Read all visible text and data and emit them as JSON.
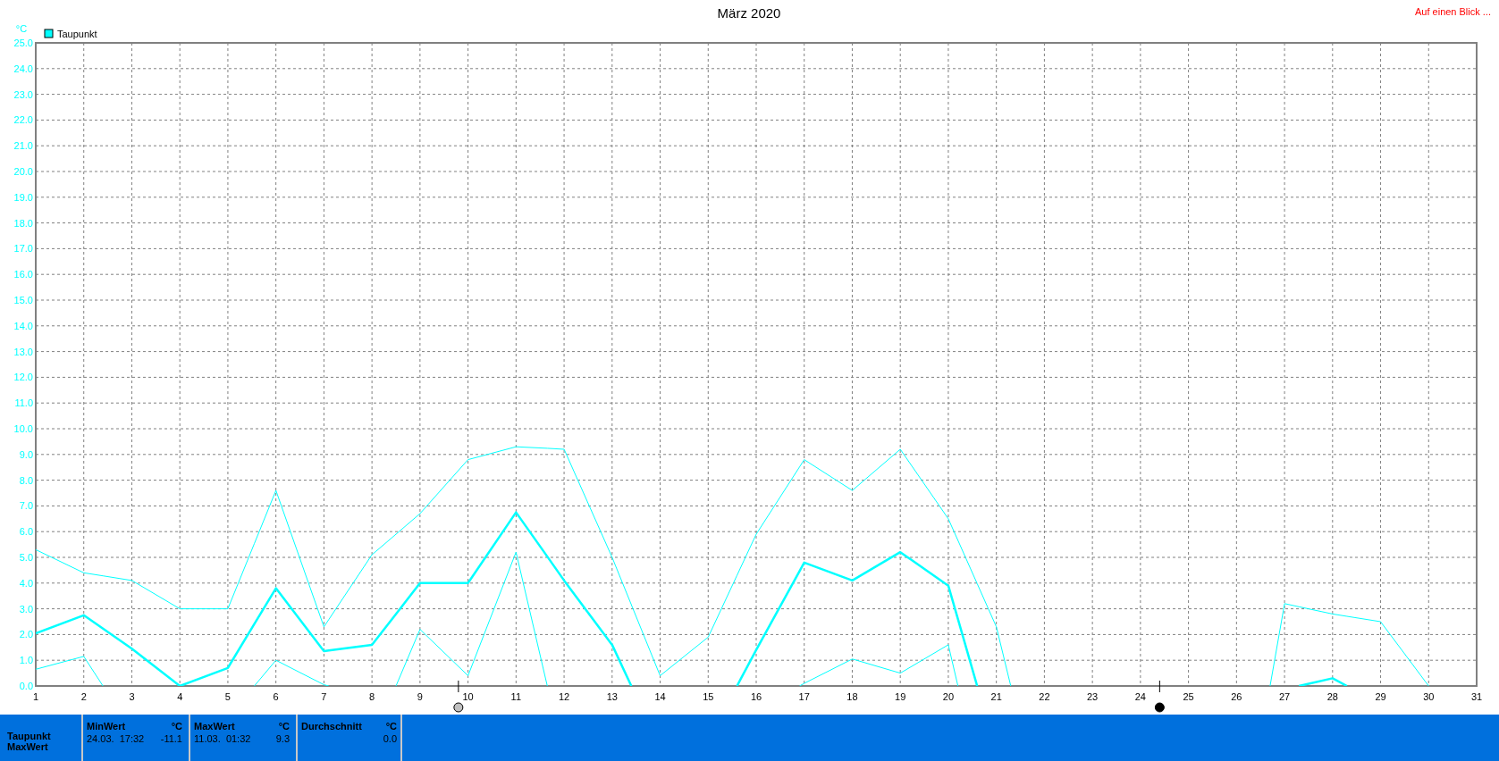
{
  "chart": {
    "unit": "°C",
    "legend": [
      {
        "label": "Taupunkt",
        "color": "#00ffff"
      }
    ],
    "chart_data": {
      "type": "line",
      "title": "März 2020",
      "xlim": [
        1,
        31
      ],
      "ylim": [
        0,
        25
      ],
      "grid": true,
      "x": [
        1,
        2,
        2.4,
        3,
        4,
        5,
        5.55,
        6,
        7,
        7.1,
        8,
        8.5,
        9,
        10,
        11,
        11.65,
        12,
        13,
        13.4,
        14,
        15,
        15.6,
        16,
        16.9,
        17,
        18,
        19,
        20,
        20.2,
        20.6,
        21,
        21.3,
        22,
        23,
        24,
        25,
        26,
        26.7,
        27,
        27.3,
        28,
        28.3,
        29,
        30
      ],
      "xticks": [
        1,
        2,
        3,
        4,
        5,
        6,
        7,
        8,
        9,
        10,
        11,
        12,
        13,
        14,
        15,
        16,
        17,
        18,
        19,
        20,
        21,
        22,
        23,
        24,
        25,
        26,
        27,
        28,
        29,
        30,
        31
      ],
      "yticks": [
        {
          "value": 0,
          "label": "0.0"
        },
        {
          "value": 1,
          "label": "1.0"
        },
        {
          "value": 2,
          "label": "2.0"
        },
        {
          "value": 3,
          "label": "3.0"
        },
        {
          "value": 4,
          "label": "4.0"
        },
        {
          "value": 5,
          "label": "5.0"
        },
        {
          "value": 6,
          "label": "6.0"
        },
        {
          "value": 7,
          "label": "7.0"
        },
        {
          "value": 8,
          "label": "8.0"
        },
        {
          "value": 9,
          "label": "9.0"
        },
        {
          "value": 10,
          "label": "10.0"
        },
        {
          "value": 11,
          "label": "11.0"
        },
        {
          "value": 12,
          "label": "12.0"
        },
        {
          "value": 13,
          "label": "13.0"
        },
        {
          "value": 14,
          "label": "14.0"
        },
        {
          "value": 15,
          "label": "15.0"
        },
        {
          "value": 16,
          "label": "16.0"
        },
        {
          "value": 17,
          "label": "17.0"
        },
        {
          "value": 18,
          "label": "18.0"
        },
        {
          "value": 19,
          "label": "19.0"
        },
        {
          "value": 20,
          "label": "20.0"
        },
        {
          "value": 21,
          "label": "21.0"
        },
        {
          "value": 22,
          "label": "22.0"
        },
        {
          "value": 23,
          "label": "23.0"
        },
        {
          "value": 24,
          "label": "24.0"
        },
        {
          "value": 25,
          "label": "25.0"
        }
      ],
      "series": [
        {
          "color": "#00ffff",
          "values": [
            5.3,
            4.4,
            4.28,
            4.1,
            3.0,
            3.0,
            5.53,
            7.6,
            2.3,
            2.58,
            5.1,
            5.9,
            6.7,
            8.8,
            9.3,
            9.24,
            9.2,
            5.0,
            3.16,
            0.4,
            1.9,
            4.3,
            5.9,
            8.51,
            8.8,
            7.6,
            9.2,
            6.5,
            5.66,
            3.98,
            2.3,
            0,
            null,
            null,
            null,
            null,
            null,
            0,
            3.2,
            3.08,
            2.8,
            2.71,
            2.5,
            0
          ]
        },
        {
          "color": "#00ffff",
          "values": [
            2.05,
            2.75,
            2.23,
            1.45,
            0,
            0.7,
            2.41,
            3.8,
            1.35,
            1.38,
            1.6,
            2.8,
            4.0,
            4.0,
            6.75,
            5.03,
            4.1,
            1.6,
            0,
            null,
            null,
            0,
            1.4,
            4.46,
            4.8,
            4.1,
            5.2,
            3.9,
            2.6,
            0,
            null,
            null,
            null,
            null,
            null,
            null,
            null,
            null,
            null,
            0,
            0.3,
            0,
            null,
            null
          ]
        },
        {
          "color": "#00ffff",
          "values": [
            0.65,
            1.15,
            0,
            null,
            null,
            null,
            0,
            1.0,
            0.05,
            0,
            null,
            0,
            2.2,
            0.4,
            5.2,
            0,
            null,
            null,
            null,
            null,
            null,
            null,
            null,
            0,
            0.1,
            1.05,
            0.5,
            1.6,
            0,
            null,
            null,
            null,
            null,
            null,
            null,
            null,
            null,
            null,
            null,
            null,
            null,
            null,
            null,
            null
          ]
        }
      ]
    }
  },
  "moon_phases": [
    {
      "kind": "full"
    },
    {
      "kind": "new"
    }
  ],
  "link": "Auf einen Blick ...",
  "summary": {
    "row_labels": [
      "Taupunkt",
      "MaxWert"
    ],
    "cards": [
      {
        "heading": "MinWert",
        "unit": "°C",
        "date": "24.03.  17:32",
        "value": "-11.1"
      },
      {
        "heading": "MaxWert",
        "unit": "°C",
        "date": "11.03.  01:32",
        "value": "9.3"
      },
      {
        "heading": "Durchschnitt",
        "unit": "°C",
        "value": "0.0"
      }
    ]
  }
}
